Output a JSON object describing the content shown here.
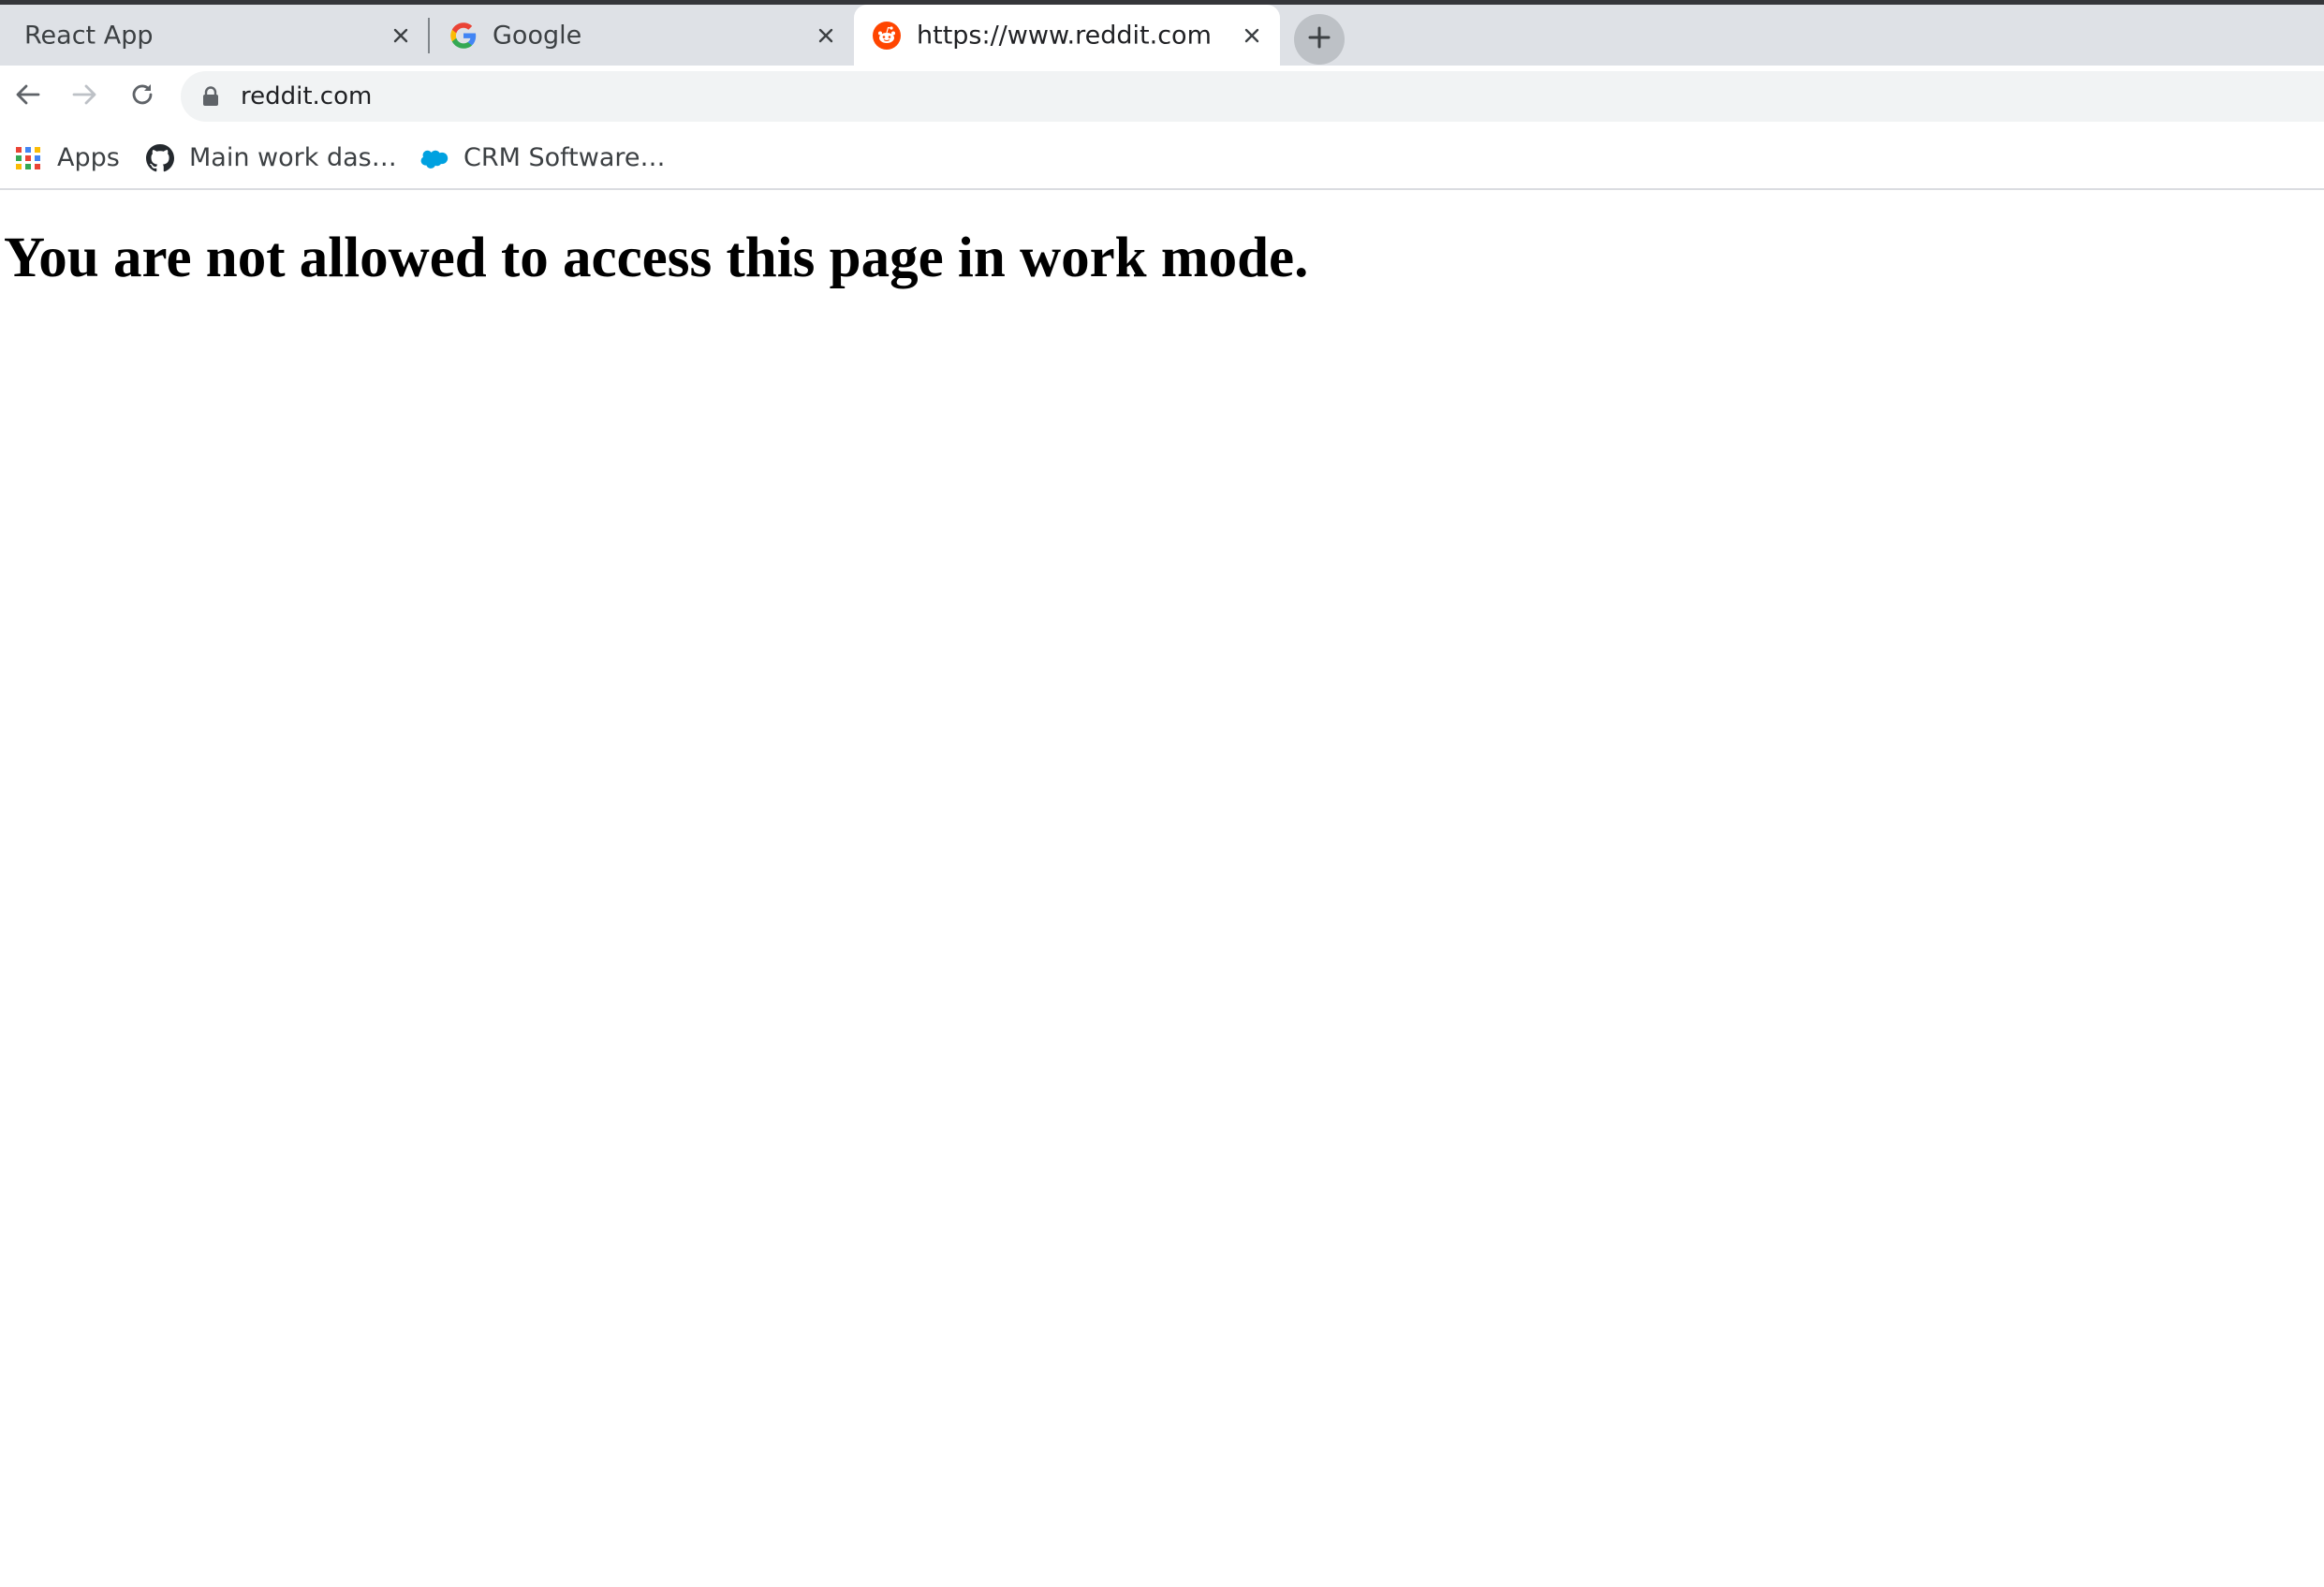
{
  "tabs": [
    {
      "title": "React App",
      "icon": "none",
      "active": false
    },
    {
      "title": "Google",
      "icon": "google-icon",
      "active": false
    },
    {
      "title": "https://www.reddit.com",
      "icon": "reddit-icon",
      "active": true
    }
  ],
  "toolbar": {
    "url": "reddit.com",
    "icons": {
      "back": "arrow-left-icon",
      "forward": "arrow-right-icon",
      "reload": "reload-icon",
      "lock": "lock-icon",
      "new_tab": "plus-icon"
    }
  },
  "bookmarks": [
    {
      "label": "Apps",
      "icon": "apps-grid-icon"
    },
    {
      "label": "Main work das…",
      "icon": "github-icon"
    },
    {
      "label": "CRM Software…",
      "icon": "salesforce-cloud-icon"
    }
  ],
  "page": {
    "heading": "You are not allowed to access this page in work mode."
  },
  "colors": {
    "tabstrip_bg": "#dee1e6",
    "active_tab_bg": "#ffffff",
    "omnibox_bg": "#f1f3f4",
    "reddit_orange": "#ff4500",
    "salesforce_blue": "#00a1e0",
    "text_primary": "#202124"
  }
}
